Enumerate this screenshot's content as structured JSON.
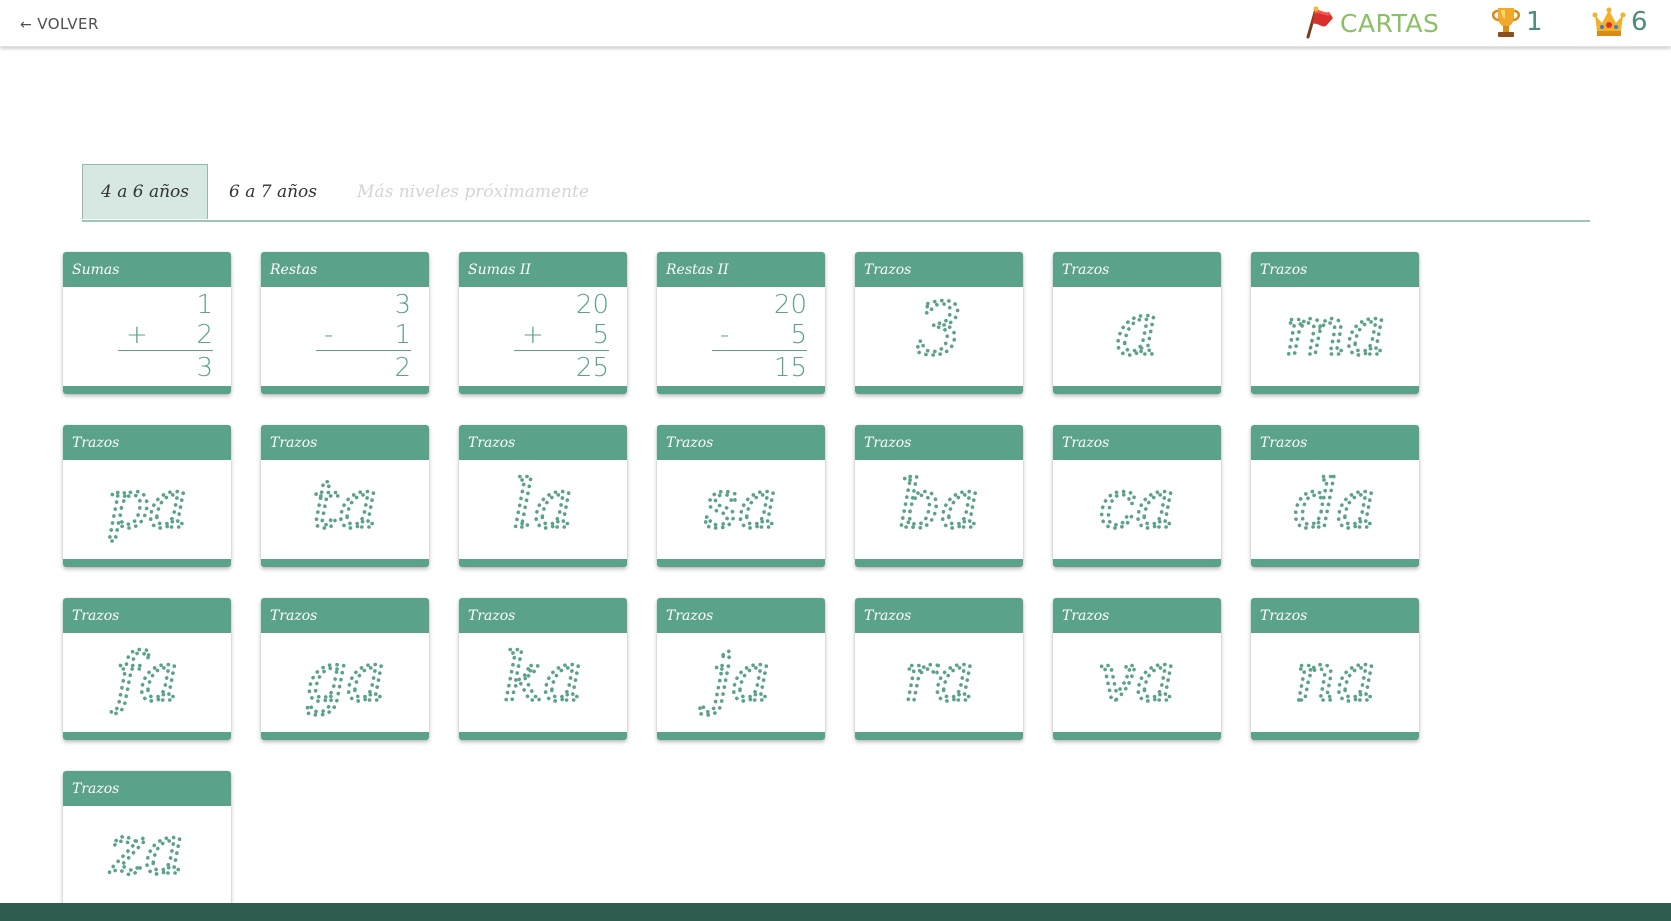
{
  "header": {
    "back_label": "VOLVER",
    "cards_label": "CARTAS",
    "trophies": "1",
    "crowns": "6"
  },
  "tabs": [
    {
      "label": "4 a 6 años",
      "active": true
    },
    {
      "label": "6 a 7 años",
      "active": false
    },
    {
      "label": "Más niveles próximamente",
      "active": false
    }
  ],
  "cards": [
    {
      "title": "Sumas",
      "kind": "math",
      "top": "1",
      "op": "+",
      "bottom": "2",
      "result": "3"
    },
    {
      "title": "Restas",
      "kind": "math",
      "top": "3",
      "op": "-",
      "bottom": "1",
      "result": "2"
    },
    {
      "title": "Sumas II",
      "kind": "math",
      "top": "20",
      "op": "+",
      "bottom": "5",
      "result": "25"
    },
    {
      "title": "Restas II",
      "kind": "math",
      "top": "20",
      "op": "-",
      "bottom": "5",
      "result": "15"
    },
    {
      "title": "Trazos",
      "kind": "trace",
      "text": "3"
    },
    {
      "title": "Trazos",
      "kind": "trace",
      "text": "a"
    },
    {
      "title": "Trazos",
      "kind": "trace",
      "text": "ma"
    },
    {
      "title": "Trazos",
      "kind": "trace",
      "text": "pa"
    },
    {
      "title": "Trazos",
      "kind": "trace",
      "text": "ta"
    },
    {
      "title": "Trazos",
      "kind": "trace",
      "text": "la"
    },
    {
      "title": "Trazos",
      "kind": "trace",
      "text": "sa"
    },
    {
      "title": "Trazos",
      "kind": "trace",
      "text": "ba"
    },
    {
      "title": "Trazos",
      "kind": "trace",
      "text": "ca"
    },
    {
      "title": "Trazos",
      "kind": "trace",
      "text": "da"
    },
    {
      "title": "Trazos",
      "kind": "trace",
      "text": "fa"
    },
    {
      "title": "Trazos",
      "kind": "trace",
      "text": "ga"
    },
    {
      "title": "Trazos",
      "kind": "trace",
      "text": "ka"
    },
    {
      "title": "Trazos",
      "kind": "trace",
      "text": "ja"
    },
    {
      "title": "Trazos",
      "kind": "trace",
      "text": "ra"
    },
    {
      "title": "Trazos",
      "kind": "trace",
      "text": "va"
    },
    {
      "title": "Trazos",
      "kind": "trace",
      "text": "na"
    },
    {
      "title": "Trazos",
      "kind": "trace",
      "text": "za"
    }
  ],
  "colors": {
    "accent": "#5ba28b",
    "cards_label": "#8bc064",
    "bottom_bar": "#2e5c50"
  },
  "icons": {
    "cards": "flag-icon",
    "trophies": "trophy-icon",
    "crowns": "crown-icon",
    "back": "arrow-left-icon"
  }
}
